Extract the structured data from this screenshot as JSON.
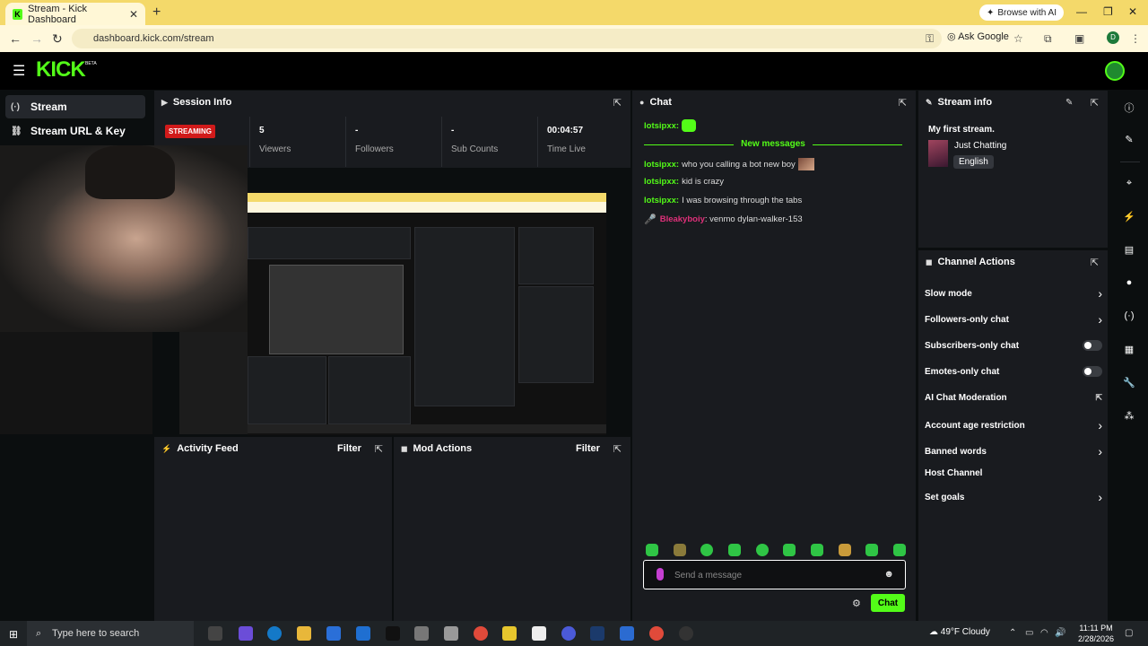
{
  "browser": {
    "tab_title": "Stream - Kick Dashboard",
    "tab_favicon": "K",
    "new_tab": "+",
    "browse_ai": "Browse with AI",
    "url": "dashboard.kick.com/stream",
    "ask_google": "Ask Google",
    "profile_initial": "D"
  },
  "header": {
    "logo": "KICK",
    "beta": "BETA"
  },
  "sidebar": {
    "items": [
      {
        "label": "Stream",
        "icon": "broadcast-icon"
      },
      {
        "label": "Stream URL & Key",
        "icon": "link-icon"
      }
    ]
  },
  "session": {
    "title": "Session Info",
    "badge": "STREAMING",
    "stats": [
      {
        "value": "5",
        "label": "Viewers"
      },
      {
        "value": "-",
        "label": "Followers"
      },
      {
        "value": "-",
        "label": "Sub Counts"
      },
      {
        "value": "00:04:57",
        "label": "Time Live"
      }
    ]
  },
  "activity": {
    "title": "Activity Feed",
    "filter": "Filter"
  },
  "mod": {
    "title": "Mod Actions",
    "filter": "Filter"
  },
  "chat": {
    "title": "Chat",
    "first_user": "lotsipxx:",
    "new_messages": "New messages",
    "messages": [
      {
        "user": "lotsipxx:",
        "text": "who you calling a bot new boy"
      },
      {
        "user": "lotsipxx:",
        "text": "kid is crazy"
      },
      {
        "user": "lotsipxx:",
        "text": "I was browsing through the tabs"
      },
      {
        "user": "Bleakyboiy",
        "text": ": venmo dylan-walker-153"
      }
    ],
    "placeholder": "Send a message",
    "send": "Chat"
  },
  "stream_info": {
    "title": "Stream info",
    "stream_title": "My first stream.",
    "category": "Just Chatting",
    "language": "English"
  },
  "channel_actions": {
    "title": "Channel Actions",
    "items": [
      {
        "label": "Slow mode",
        "control": "chevron"
      },
      {
        "label": "Followers-only chat",
        "control": "chevron"
      },
      {
        "label": "Subscribers-only chat",
        "control": "toggle"
      },
      {
        "label": "Emotes-only chat",
        "control": "toggle"
      },
      {
        "label": "AI Chat Moderation",
        "control": "external"
      },
      {
        "label": "Account age restriction",
        "control": "chevron"
      },
      {
        "label": "Banned words",
        "control": "chevron"
      },
      {
        "label": "Host Channel",
        "control": "none"
      },
      {
        "label": "Set goals",
        "control": "chevron"
      }
    ]
  },
  "taskbar": {
    "search_placeholder": "Type here to search",
    "weather": "49°F  Cloudy",
    "time": "11:11 PM",
    "date": "2/28/2026"
  },
  "colors": {
    "accent": "#53fc18",
    "streaming": "#d11a1a",
    "panel": "#191b1f"
  }
}
